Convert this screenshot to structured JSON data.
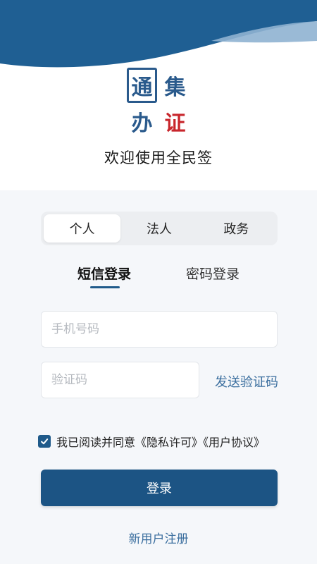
{
  "header": {
    "logo_chars": [
      "通",
      "集",
      "办",
      "证"
    ],
    "welcome": "欢迎使用全民签"
  },
  "user_type": {
    "options": [
      "个人",
      "法人",
      "政务"
    ],
    "selected": "个人"
  },
  "login_tabs": {
    "sms": "短信登录",
    "password": "密码登录",
    "active": "短信登录"
  },
  "form": {
    "phone_placeholder": "手机号码",
    "phone_value": "",
    "code_placeholder": "验证码",
    "code_value": "",
    "send_code": "发送验证码"
  },
  "agreement": {
    "checked": true,
    "prefix": "我已阅读并同意",
    "privacy": "《隐私许可》",
    "terms": "《用户协议》"
  },
  "actions": {
    "login": "登录",
    "register": "新用户注册"
  },
  "colors": {
    "primary": "#1c5484",
    "link": "#3a6e9e",
    "logo_blue": "#2a5a8c",
    "logo_red": "#c8262c"
  }
}
